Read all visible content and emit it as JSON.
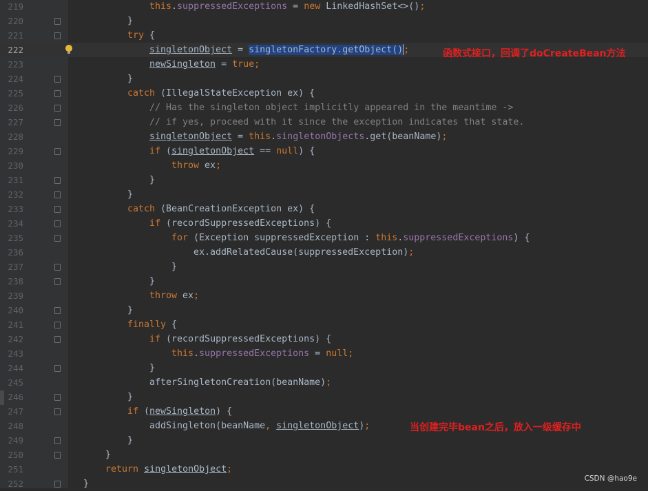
{
  "editor": {
    "lines": [
      {
        "num": "219",
        "fold": false,
        "indent": 6,
        "tokens": [
          {
            "t": "this",
            "c": "kw"
          },
          {
            "t": "."
          },
          {
            "t": "suppressedExceptions",
            "c": "fld"
          },
          {
            "t": " = "
          },
          {
            "t": "new",
            "c": "kw"
          },
          {
            "t": " LinkedHashSet<>()"
          },
          {
            "t": ";",
            "c": "kw"
          }
        ]
      },
      {
        "num": "220",
        "fold": true,
        "indent": 5,
        "tokens": [
          {
            "t": "}"
          }
        ]
      },
      {
        "num": "221",
        "fold": true,
        "indent": 5,
        "tokens": [
          {
            "t": "try",
            "c": "kw"
          },
          {
            "t": " {"
          }
        ]
      },
      {
        "num": "222",
        "fold": false,
        "indent": 6,
        "current": true,
        "bulb": true,
        "tokens": [
          {
            "t": "singletonObject",
            "c": "ul"
          },
          {
            "t": " = "
          },
          {
            "t": "singletonFactory.getObject()",
            "c": "sel"
          },
          {
            "caret": true
          },
          {
            "t": ";",
            "c": "kw"
          }
        ]
      },
      {
        "num": "223",
        "fold": false,
        "indent": 6,
        "tokens": [
          {
            "t": "newSingleton",
            "c": "ul"
          },
          {
            "t": " = "
          },
          {
            "t": "true",
            "c": "kw"
          },
          {
            "t": ";",
            "c": "kw"
          }
        ]
      },
      {
        "num": "224",
        "fold": true,
        "indent": 5,
        "tokens": [
          {
            "t": "}"
          }
        ]
      },
      {
        "num": "225",
        "fold": true,
        "indent": 5,
        "tokens": [
          {
            "t": "catch",
            "c": "kw"
          },
          {
            "t": " (IllegalStateException ex) {"
          }
        ]
      },
      {
        "num": "226",
        "fold": true,
        "indent": 6,
        "tokens": [
          {
            "t": "// Has the singleton object implicitly appeared in the meantime ->",
            "c": "cmt"
          }
        ]
      },
      {
        "num": "227",
        "fold": true,
        "indent": 6,
        "tokens": [
          {
            "t": "// if yes, proceed with it since the exception indicates that state.",
            "c": "cmt"
          }
        ]
      },
      {
        "num": "228",
        "fold": false,
        "indent": 6,
        "tokens": [
          {
            "t": "singletonObject",
            "c": "ul"
          },
          {
            "t": " = "
          },
          {
            "t": "this",
            "c": "kw"
          },
          {
            "t": "."
          },
          {
            "t": "singletonObjects",
            "c": "fld"
          },
          {
            "t": ".get(beanName)"
          },
          {
            "t": ";",
            "c": "kw"
          }
        ]
      },
      {
        "num": "229",
        "fold": true,
        "indent": 6,
        "tokens": [
          {
            "t": "if",
            "c": "kw"
          },
          {
            "t": " ("
          },
          {
            "t": "singletonObject",
            "c": "ul"
          },
          {
            "t": " == "
          },
          {
            "t": "null",
            "c": "kw"
          },
          {
            "t": ") {"
          }
        ]
      },
      {
        "num": "230",
        "fold": false,
        "indent": 7,
        "tokens": [
          {
            "t": "throw",
            "c": "kw"
          },
          {
            "t": " ex"
          },
          {
            "t": ";",
            "c": "kw"
          }
        ]
      },
      {
        "num": "231",
        "fold": true,
        "indent": 6,
        "tokens": [
          {
            "t": "}"
          }
        ]
      },
      {
        "num": "232",
        "fold": true,
        "indent": 5,
        "tokens": [
          {
            "t": "}"
          }
        ]
      },
      {
        "num": "233",
        "fold": true,
        "indent": 5,
        "tokens": [
          {
            "t": "catch",
            "c": "kw"
          },
          {
            "t": " (BeanCreationException ex) {"
          }
        ]
      },
      {
        "num": "234",
        "fold": true,
        "indent": 6,
        "tokens": [
          {
            "t": "if",
            "c": "kw"
          },
          {
            "t": " (recordSuppressedExceptions) {"
          }
        ]
      },
      {
        "num": "235",
        "fold": true,
        "indent": 7,
        "tokens": [
          {
            "t": "for",
            "c": "kw"
          },
          {
            "t": " (Exception suppressedException : "
          },
          {
            "t": "this",
            "c": "kw"
          },
          {
            "t": "."
          },
          {
            "t": "suppressedExceptions",
            "c": "fld"
          },
          {
            "t": ") {"
          }
        ]
      },
      {
        "num": "236",
        "fold": false,
        "indent": 8,
        "tokens": [
          {
            "t": "ex.addRelatedCause(suppressedException)"
          },
          {
            "t": ";",
            "c": "kw"
          }
        ]
      },
      {
        "num": "237",
        "fold": true,
        "indent": 7,
        "tokens": [
          {
            "t": "}"
          }
        ]
      },
      {
        "num": "238",
        "fold": true,
        "indent": 6,
        "tokens": [
          {
            "t": "}"
          }
        ]
      },
      {
        "num": "239",
        "fold": false,
        "indent": 6,
        "tokens": [
          {
            "t": "throw",
            "c": "kw"
          },
          {
            "t": " ex"
          },
          {
            "t": ";",
            "c": "kw"
          }
        ]
      },
      {
        "num": "240",
        "fold": true,
        "indent": 5,
        "tokens": [
          {
            "t": "}"
          }
        ]
      },
      {
        "num": "241",
        "fold": true,
        "indent": 5,
        "tokens": [
          {
            "t": "finally",
            "c": "kw"
          },
          {
            "t": " {"
          }
        ]
      },
      {
        "num": "242",
        "fold": true,
        "indent": 6,
        "tokens": [
          {
            "t": "if",
            "c": "kw"
          },
          {
            "t": " (recordSuppressedExceptions) {"
          }
        ]
      },
      {
        "num": "243",
        "fold": false,
        "indent": 7,
        "tokens": [
          {
            "t": "this",
            "c": "kw"
          },
          {
            "t": "."
          },
          {
            "t": "suppressedExceptions",
            "c": "fld"
          },
          {
            "t": " = "
          },
          {
            "t": "null",
            "c": "kw"
          },
          {
            "t": ";",
            "c": "kw"
          }
        ]
      },
      {
        "num": "244",
        "fold": true,
        "indent": 6,
        "tokens": [
          {
            "t": "}"
          }
        ]
      },
      {
        "num": "245",
        "fold": false,
        "indent": 6,
        "tokens": [
          {
            "t": "afterSingletonCreation(beanName)"
          },
          {
            "t": ";",
            "c": "kw"
          }
        ]
      },
      {
        "num": "246",
        "fold": true,
        "indent": 5,
        "tokens": [
          {
            "t": "}"
          }
        ]
      },
      {
        "num": "247",
        "fold": true,
        "indent": 5,
        "tokens": [
          {
            "t": "if",
            "c": "kw"
          },
          {
            "t": " ("
          },
          {
            "t": "newSingleton",
            "c": "ul"
          },
          {
            "t": ") {"
          }
        ]
      },
      {
        "num": "248",
        "fold": false,
        "indent": 6,
        "tokens": [
          {
            "t": "addSingleton(beanName"
          },
          {
            "t": ", ",
            "c": "kw"
          },
          {
            "t": "singletonObject",
            "c": "ul"
          },
          {
            "t": ")"
          },
          {
            "t": ";",
            "c": "kw"
          }
        ]
      },
      {
        "num": "249",
        "fold": true,
        "indent": 5,
        "tokens": [
          {
            "t": "}"
          }
        ]
      },
      {
        "num": "250",
        "fold": true,
        "indent": 4,
        "tokens": [
          {
            "t": "}"
          }
        ]
      },
      {
        "num": "251",
        "fold": false,
        "indent": 4,
        "tokens": [
          {
            "t": "return",
            "c": "kw"
          },
          {
            "t": " "
          },
          {
            "t": "singletonObject",
            "c": "ul"
          },
          {
            "t": ";",
            "c": "kw"
          }
        ]
      },
      {
        "num": "252",
        "fold": true,
        "indent": 3,
        "tokens": [
          {
            "t": "}"
          }
        ]
      }
    ]
  },
  "annotations": {
    "note1": "函数式接口，回调了doCreateBean方法",
    "note2": "当创建完毕bean之后，放入一级缓存中"
  },
  "footer": {
    "credit": "CSDN @hao9e"
  },
  "colors": {
    "background": "#2b2b2b",
    "keyword": "#cc7832",
    "field": "#9876aa",
    "comment": "#808080",
    "selection": "#214283",
    "annotation": "#e02020"
  }
}
